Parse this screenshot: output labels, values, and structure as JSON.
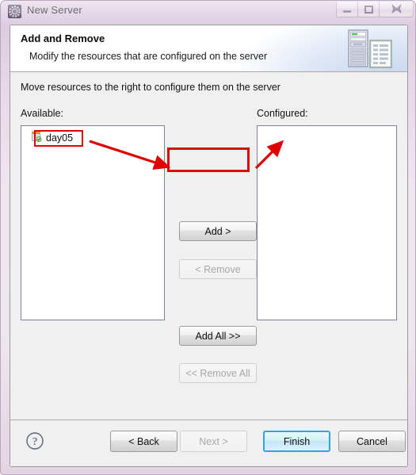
{
  "window": {
    "title": "New Server",
    "icon": "server-gear-icon",
    "controls": {
      "minimize": "minimize-icon",
      "maximize": "maximize-icon",
      "close": "close-icon"
    }
  },
  "banner": {
    "title": "Add and Remove",
    "subtitle": "Modify the resources that are configured on the server",
    "icon": "server-rack-document-icon"
  },
  "main": {
    "instruction": "Move resources to the right to configure them on the server",
    "available_label": "Available:",
    "configured_label": "Configured:",
    "available_items": [
      {
        "label": "day05",
        "icon": "web-project-icon"
      }
    ],
    "configured_items": [],
    "buttons": [
      {
        "label": "Add >",
        "name": "add-button",
        "enabled": true,
        "highlighted": true
      },
      {
        "label": "< Remove",
        "name": "remove-button",
        "enabled": false,
        "highlighted": false
      },
      {
        "label": "Add All >>",
        "name": "add-all-button",
        "enabled": true,
        "highlighted": false
      },
      {
        "label": "<< Remove All",
        "name": "remove-all-button",
        "enabled": false,
        "highlighted": false
      }
    ]
  },
  "footer": {
    "help_icon": "help-question-icon",
    "back_label": "< Back",
    "next_label": "Next >",
    "finish_label": "Finish",
    "cancel_label": "Cancel"
  },
  "annotations": {
    "highlight_color": "#e00000",
    "boxes": [
      "day05-item",
      "add-button"
    ],
    "arrows": [
      "day05-to-add-button",
      "add-button-to-configured-list"
    ]
  },
  "colors": {
    "titlebar_gradient_top": "#d9c6dd",
    "titlebar_gradient_mid": "#f0e6f0",
    "dialog_background": "#f0f0f0",
    "banner_background": "#ffffff",
    "default_button_border": "#2ba6e0",
    "annotation_red": "#e00000"
  }
}
